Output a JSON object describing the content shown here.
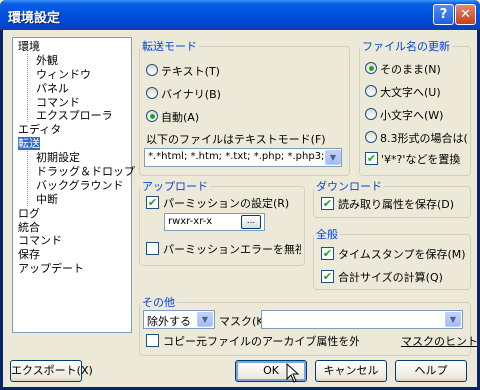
{
  "window": {
    "title": "環境設定",
    "help_glyph": "?",
    "close_glyph": "✕"
  },
  "tree": [
    {
      "label": "環境",
      "level": 1
    },
    {
      "label": "外観",
      "level": 2
    },
    {
      "label": "ウィンドウ",
      "level": 2
    },
    {
      "label": "パネル",
      "level": 2
    },
    {
      "label": "コマンド",
      "level": 2
    },
    {
      "label": "エクスプローラ",
      "level": 2
    },
    {
      "label": "エディタ",
      "level": 1
    },
    {
      "label": "転送",
      "level": 1,
      "selected": true
    },
    {
      "label": "初期設定",
      "level": 2
    },
    {
      "label": "ドラッグ＆ドロップ",
      "level": 2
    },
    {
      "label": "バックグラウンド",
      "level": 2
    },
    {
      "label": "中断",
      "level": 2
    },
    {
      "label": "ログ",
      "level": 1
    },
    {
      "label": "統合",
      "level": 1
    },
    {
      "label": "コマンド",
      "level": 1
    },
    {
      "label": "保存",
      "level": 1
    },
    {
      "label": "アップデート",
      "level": 1
    }
  ],
  "transfer_mode": {
    "legend": "転送モード",
    "text": "テキスト(T)",
    "binary": "バイナリ(B)",
    "auto": "自動(A)",
    "selected": "auto",
    "file_label": "以下のファイルはテキストモード(F)",
    "file_value": "*.*html; *.htm; *.txt; *.php; *.php3; *"
  },
  "filename": {
    "legend": "ファイル名の更新",
    "keep": "そのまま(N)",
    "upper": "大文字へ(U)",
    "lower": "小文字へ(W)",
    "dos83": "8.3形式の場合は(",
    "selected": "keep",
    "replace_label": "'¥*?'などを置換",
    "replace_checked": true
  },
  "upload": {
    "legend": "アップロード",
    "perm_label": "パーミッションの設定(R)",
    "perm_checked": true,
    "perm_value": "rwxr-xr-x",
    "perm_btn": "...",
    "ignore_label": "パーミッションエラーを無視(C",
    "ignore_checked": false
  },
  "download": {
    "legend": "ダウンロード",
    "readonly_label": "読み取り属性を保存(D)",
    "readonly_checked": true
  },
  "general": {
    "legend": "全般",
    "timestamp_label": "タイムスタンプを保存(M)",
    "timestamp_checked": true,
    "totalsize_label": "合計サイズの計算(Q)",
    "totalsize_checked": true
  },
  "other": {
    "legend": "その他",
    "exclude_value": "除外する",
    "mask_label": "マスク(K)",
    "mask_value": "",
    "archive_label": "コピー元ファイルのアーカイブ属性を外す(V",
    "archive_checked": false,
    "mask_hint": "マスクのヒント"
  },
  "buttons": {
    "export": "エクスポート(X)",
    "ok": "OK",
    "cancel": "キャンセル",
    "help": "ヘルプ"
  },
  "glyphs": {
    "check": "✔",
    "dropdown": "▼"
  },
  "colors": {
    "title_bar": "#0054e3",
    "selection": "#316ac5",
    "group_legend": "#0046d5"
  }
}
